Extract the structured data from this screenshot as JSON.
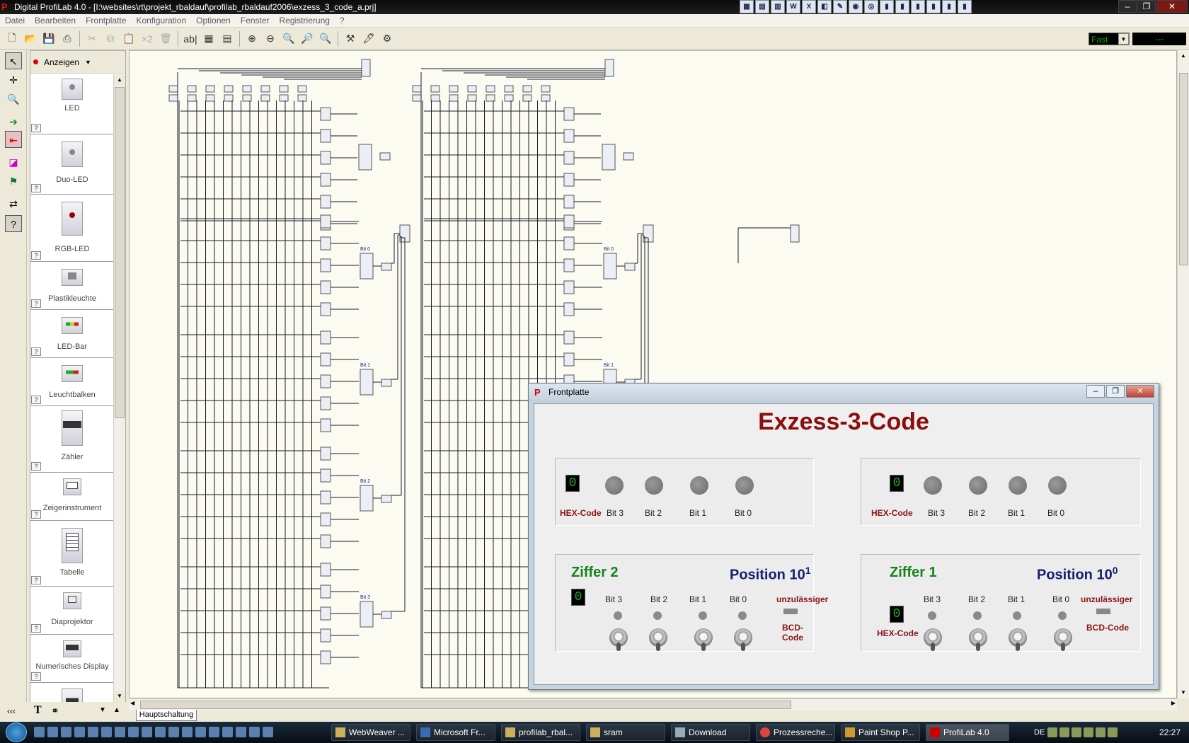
{
  "window": {
    "title": "Digital ProfiLab 4.0 - [I:\\websites\\rt\\projekt_rbaldauf\\profilab_rbaldauf2006\\exzess_3_code_a.prj]"
  },
  "menu": [
    "Datei",
    "Bearbeiten",
    "Frontplatte",
    "Konfiguration",
    "Optionen",
    "Fenster",
    "Registrierung",
    "?"
  ],
  "toolbar": {
    "x2_label": "×2",
    "abl_label": "ab|",
    "speed_value": "Fast",
    "speed_display": "---"
  },
  "palette": {
    "header": "Anzeigen",
    "items": [
      {
        "label": "LED",
        "tag": "LED0"
      },
      {
        "label": "Duo-LED",
        "tag": "DLED0"
      },
      {
        "label": "RGB-LED",
        "tag": "RGB0"
      },
      {
        "label": "Plastikleuchte",
        "tag": "LA0"
      },
      {
        "label": "LED-Bar",
        "tag": "LB0"
      },
      {
        "label": "Leuchtbalken",
        "tag": "LB0"
      },
      {
        "label": "Zähler",
        "tag": "CO0"
      },
      {
        "label": "Zeigerinstrument",
        "tag": "M0"
      },
      {
        "label": "Tabelle",
        "tag": "TAB0"
      },
      {
        "label": "Diaprojektor",
        "tag": "PJ0"
      },
      {
        "label": "Numerisches Display",
        "tag": "ND0"
      },
      {
        "label": "",
        "tag": "TXT"
      }
    ]
  },
  "canvas": {
    "sheet_tab": "Hauptschaltung",
    "bit_labels": [
      "Bit 0",
      "Bit 1",
      "Bit 2",
      "Bit 3"
    ]
  },
  "frontplatte": {
    "window_title": "Frontplatte",
    "heading": "Exzess-3-Code",
    "display_panels": [
      {
        "hex_value": "0",
        "hex_label": "HEX-Code",
        "bits": [
          "Bit 3",
          "Bit 2",
          "Bit 1",
          "Bit 0"
        ]
      },
      {
        "hex_value": "0",
        "hex_label": "HEX-Code",
        "bits": [
          "Bit 3",
          "Bit 2",
          "Bit 1",
          "Bit 0"
        ]
      }
    ],
    "input_panels": [
      {
        "ziffer": "Ziffer 2",
        "position": "Position 10",
        "exponent": "1",
        "hex_value": "0",
        "hex_label": "",
        "bits": [
          "Bit 3",
          "Bit 2",
          "Bit 1",
          "Bit 0"
        ],
        "error_label_1": "unzulässiger",
        "error_label_2": "BCD-Code"
      },
      {
        "ziffer": "Ziffer 1",
        "position": "Position 10",
        "exponent": "0",
        "hex_value": "0",
        "hex_label": "HEX-Code",
        "bits": [
          "Bit 3",
          "Bit 2",
          "Bit 1",
          "Bit 0"
        ],
        "error_label_1": "unzulässiger",
        "error_label_2": "BCD-Code"
      }
    ]
  },
  "taskbar": {
    "tasks": [
      {
        "label": "WebWeaver ...",
        "active": false
      },
      {
        "label": "Microsoft Fr...",
        "active": false
      },
      {
        "label": "profilab_rbal...",
        "active": false
      },
      {
        "label": "sram",
        "active": false
      },
      {
        "label": "Download",
        "active": false
      },
      {
        "label": "Prozessreche...",
        "active": false
      },
      {
        "label": "Paint Shop P...",
        "active": false
      },
      {
        "label": "ProfiLab 4.0",
        "active": true
      }
    ],
    "language": "DE",
    "clock": "22:27"
  }
}
